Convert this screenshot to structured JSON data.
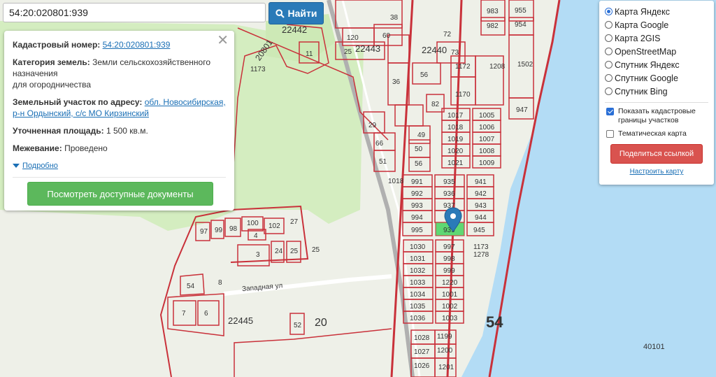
{
  "search": {
    "value": "54:20:020801:939",
    "button_label": "Найти"
  },
  "info": {
    "cadastral_label": "Кадастровый номер:",
    "cadastral_value": "54:20:020801:939",
    "category_label": "Категория земель:",
    "category_value": "Земли сельскохозяйственного назначения",
    "category_use": "для огородничества",
    "address_label": "Земельный участок по адресу:",
    "address_value": "обл. Новосибирская, р-н Ордынский, с/с МО Кирзинский",
    "area_label": "Уточненная площадь:",
    "area_value": "1 500 кв.м.",
    "survey_label": "Межевание:",
    "survey_value": "Проведено",
    "more_label": "Подробно",
    "docs_button": "Посмотреть доступные документы"
  },
  "layers": {
    "options": [
      "Карта Яндекс",
      "Карта Google",
      "Карта 2GIS",
      "OpenStreetMap",
      "Спутник Яндекс",
      "Спутник Google",
      "Спутник Bing"
    ],
    "selected": "Карта Яндекс",
    "show_cadastral_label": "Показать кадастровые границы участков",
    "show_cadastral_checked": true,
    "thematic_label": "Тематическая карта",
    "thematic_checked": false,
    "share_button": "Поделиться ссылкой",
    "setup_link": "Настроить карту"
  },
  "map": {
    "street_label": "Западная ул",
    "area_labels": [
      "22442",
      "22443",
      "22440",
      "20801",
      "1173",
      "22445",
      "20",
      "54",
      "40101"
    ],
    "plot_labels": [
      "38",
      "983",
      "955",
      "982",
      "954",
      "72",
      "120",
      "60",
      "25",
      "11",
      "73",
      "1208",
      "1502",
      "1172",
      "56",
      "36",
      "1170",
      "947",
      "82",
      "29",
      "49",
      "1017",
      "1005",
      "1018",
      "1006",
      "66",
      "1019",
      "1007",
      "50",
      "1020",
      "1008",
      "51",
      "56",
      "1021",
      "1009",
      "1018",
      "991",
      "935",
      "941",
      "992",
      "936",
      "942",
      "993",
      "937",
      "943",
      "994",
      "944",
      "995",
      "939",
      "945",
      "100",
      "102",
      "27",
      "97",
      "99",
      "98",
      "4",
      "1030",
      "997",
      "1173",
      "1278",
      "3",
      "24",
      "25",
      "25",
      "1031",
      "998",
      "1032",
      "999",
      "54",
      "8",
      "1033",
      "1220",
      "1034",
      "1001",
      "7",
      "6",
      "1035",
      "1002",
      "1036",
      "1003",
      "52",
      "1028",
      "1199",
      "1027",
      "1200",
      "1026",
      "1201"
    ],
    "colors": {
      "water": "#b3dcf5",
      "forest": "#d4edc0",
      "boundary": "#c9313a",
      "highlight": "#5fd873",
      "marker": "#2a7ab8"
    }
  }
}
